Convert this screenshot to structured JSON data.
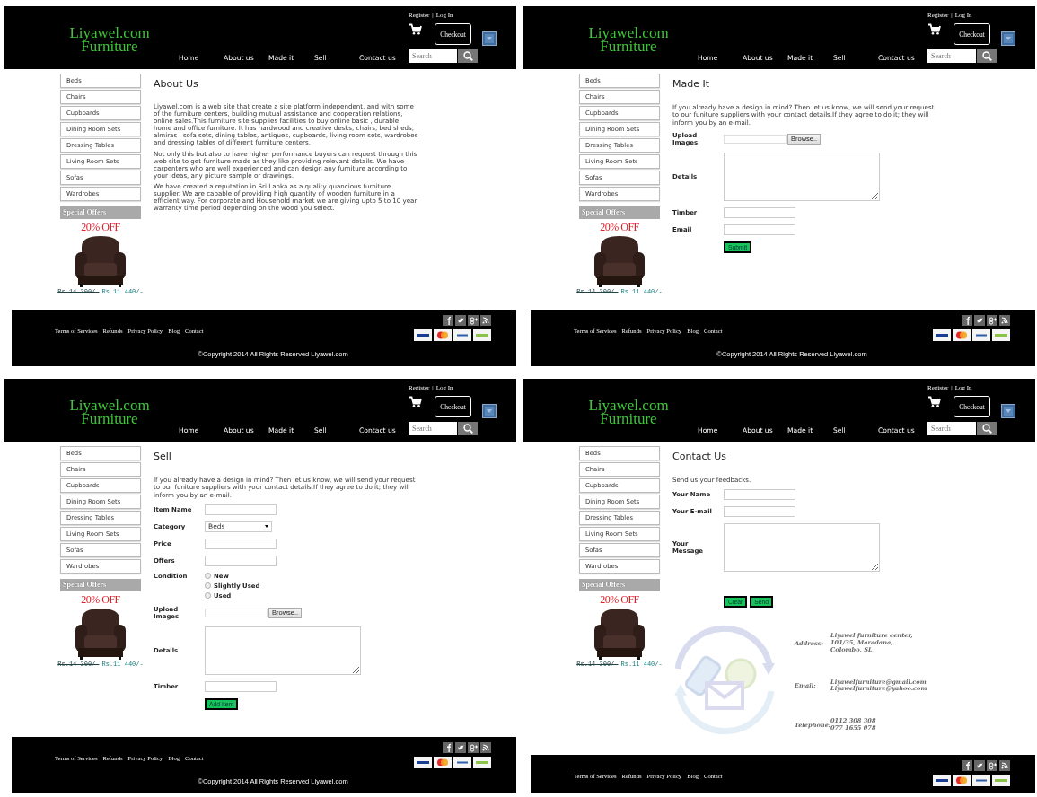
{
  "panels": [
    {
      "header": {
        "logo": [
          "Liyawel.com",
          "Furniture"
        ],
        "nav": [
          "Home",
          "About us",
          "Made it",
          "Sell",
          "Contact us"
        ],
        "account_links": [
          "Register",
          "Log In"
        ],
        "account_separator": "|",
        "checkout": "Checkout",
        "search_placeholder": "Search"
      },
      "sidebar": [
        "Beds",
        "Chairs",
        "Cupboards",
        "Dining Room Sets",
        "Dressing Tables",
        "Living Room Sets",
        "Sofas",
        "Wardrobes"
      ],
      "offers": {
        "title": "Special Offers",
        "banner": "20% OFF",
        "old_price": "Rs.14 300/-",
        "price": "Rs.11 440/-"
      },
      "page": {
        "kind": "about",
        "title": "About Us",
        "paragraphs": [
          "Liyawel.com is a web site that create a site platform independent, and with some of the furniture centers, building mutual assistance and cooperation relations, online sales.This furniture site supplies facilities to buy online basic , durable home and office furniture. It has hardwood and creative desks, chairs, bed sheds, almiras , sofa sets, dining tables, antiques, cupboards, living room sets, wardrobes and dressing tables of different furniture centers.",
          "Not only this but also to have higher performance buyers can request through this web site to get furniture made as they like providing relevant details. We have carpenters who are well experienced and can design any furniture according to your ideas, any picture sample or drawings.",
          "We have created a reputation in Sri Lanka as a quality quancious furniture supplier. We are capable of providing high quantity of wooden furniture in a efficient way. For corporate and Household market we are giving upto 5 to 10 year warranty time period depending on the wood you select."
        ]
      },
      "footer": {
        "links": [
          "Terms of Services",
          "Refunds",
          "Privacy Policy",
          "Blog",
          "Contact"
        ],
        "copyright": "©Copyright 2014 All Rights Reserved Liyawel.com"
      }
    },
    {
      "header": {
        "logo": [
          "Liyawel.com",
          "Furniture"
        ],
        "nav": [
          "Home",
          "About us",
          "Made it",
          "Sell",
          "Contact us"
        ],
        "account_links": [
          "Register",
          "Log In"
        ],
        "account_separator": "|",
        "checkout": "Checkout",
        "search_placeholder": "Search"
      },
      "sidebar": [
        "Beds",
        "Chairs",
        "Cupboards",
        "Dining Room Sets",
        "Dressing Tables",
        "Living Room Sets",
        "Sofas",
        "Wardrobes"
      ],
      "offers": {
        "title": "Special Offers",
        "banner": "20% OFF",
        "old_price": "Rs.14 300/-",
        "price": "Rs.11 440/-"
      },
      "page": {
        "kind": "form",
        "title": "Made It",
        "intro": "If you already have a design in mind? Then let us know, we will send your request to our funiture suppliers with your contact details.If they agree to do it; they will inform you by an e-mail.",
        "fields": [
          {
            "kind": "file",
            "label": "Upload Images",
            "button": "Browse.."
          },
          {
            "kind": "textarea",
            "label": "Details"
          },
          {
            "kind": "text",
            "label": "Timber"
          },
          {
            "kind": "text",
            "label": "Email"
          }
        ],
        "buttons": [
          "Submit"
        ]
      },
      "footer": {
        "links": [
          "Terms of Services",
          "Refunds",
          "Privacy Policy",
          "Blog",
          "Contact"
        ],
        "copyright": "©Copyright 2014 All Rights Reserved Liyawel.com"
      }
    },
    {
      "header": {
        "logo": [
          "Liyawel.com",
          "Furniture"
        ],
        "nav": [
          "Home",
          "About us",
          "Made it",
          "Sell",
          "Contact us"
        ],
        "account_links": [
          "Register",
          "Log In"
        ],
        "account_separator": "|",
        "checkout": "Checkout",
        "search_placeholder": "Search"
      },
      "sidebar": [
        "Beds",
        "Chairs",
        "Cupboards",
        "Dining Room Sets",
        "Dressing Tables",
        "Living Room Sets",
        "Sofas",
        "Wardrobes"
      ],
      "offers": {
        "title": "Special Offers",
        "banner": "20% OFF",
        "old_price": "Rs.14 300/-",
        "price": "Rs.11 440/-"
      },
      "page": {
        "kind": "form",
        "title": "Sell",
        "intro": "If you already have a design in mind? Then let us know, we will send your request to our funiture suppliers with your contact details.If they agree to do it; they will inform you by an e-mail.",
        "fields": [
          {
            "kind": "text",
            "label": "Item Name"
          },
          {
            "kind": "select",
            "label": "Category",
            "value": "Beds"
          },
          {
            "kind": "text",
            "label": "Price"
          },
          {
            "kind": "text",
            "label": "Offers"
          },
          {
            "kind": "radios",
            "label": "Condition",
            "options": [
              {
                "label": "New",
                "selected": false
              },
              {
                "label": "Slightly Used",
                "selected": false
              },
              {
                "label": "Used",
                "selected": false
              }
            ]
          },
          {
            "kind": "file",
            "label": "Upload Images",
            "button": "Browse.."
          },
          {
            "kind": "textarea",
            "label": "Details"
          },
          {
            "kind": "text",
            "label": "Timber"
          }
        ],
        "buttons": [
          "Add Item"
        ]
      },
      "footer": {
        "links": [
          "Terms of Services",
          "Refunds",
          "Privacy Policy",
          "Blog",
          "Contact"
        ],
        "copyright": "©Copyright 2014 All Rights Reserved Liyawel.com"
      }
    },
    {
      "header": {
        "logo": [
          "Liyawel.com",
          "Furniture"
        ],
        "nav": [
          "Home",
          "About us",
          "Made it",
          "Sell",
          "Contact us"
        ],
        "account_links": [
          "Register",
          "Log In"
        ],
        "account_separator": "|",
        "checkout": "Checkout",
        "search_placeholder": "Search"
      },
      "sidebar": [
        "Beds",
        "Chairs",
        "Cupboards",
        "Dining Room Sets",
        "Dressing Tables",
        "Living Room Sets",
        "Sofas",
        "Wardrobes"
      ],
      "offers": {
        "title": "Special Offers",
        "banner": "20% OFF",
        "old_price": "Rs.14 300/-",
        "price": "Rs.11 440/-"
      },
      "page": {
        "kind": "form",
        "title": "Contact Us",
        "intro": "Send us your feedbacks.",
        "fields": [
          {
            "kind": "text",
            "label": "Your Name"
          },
          {
            "kind": "text",
            "label": "Your E-mail"
          },
          {
            "kind": "textarea",
            "label": "Your Message"
          }
        ],
        "buttons": [
          "Clear",
          "Send"
        ],
        "contact_info": [
          {
            "label": "Address:",
            "lines": [
              "Liyawel furniture center,",
              "101/35, Maradana,",
              "Colombo, SL"
            ]
          },
          {
            "label": "Email:",
            "lines": [
              "Liyawelfurniture@gmail.com",
              "Liyawelfurniture@yahoo.com"
            ]
          },
          {
            "label": "Telephone:",
            "lines": [
              "0112 308 308",
              "077 1655 078"
            ]
          }
        ]
      },
      "footer": {
        "links": [
          "Terms of Services",
          "Refunds",
          "Privacy Policy",
          "Blog",
          "Contact"
        ]
      }
    }
  ]
}
